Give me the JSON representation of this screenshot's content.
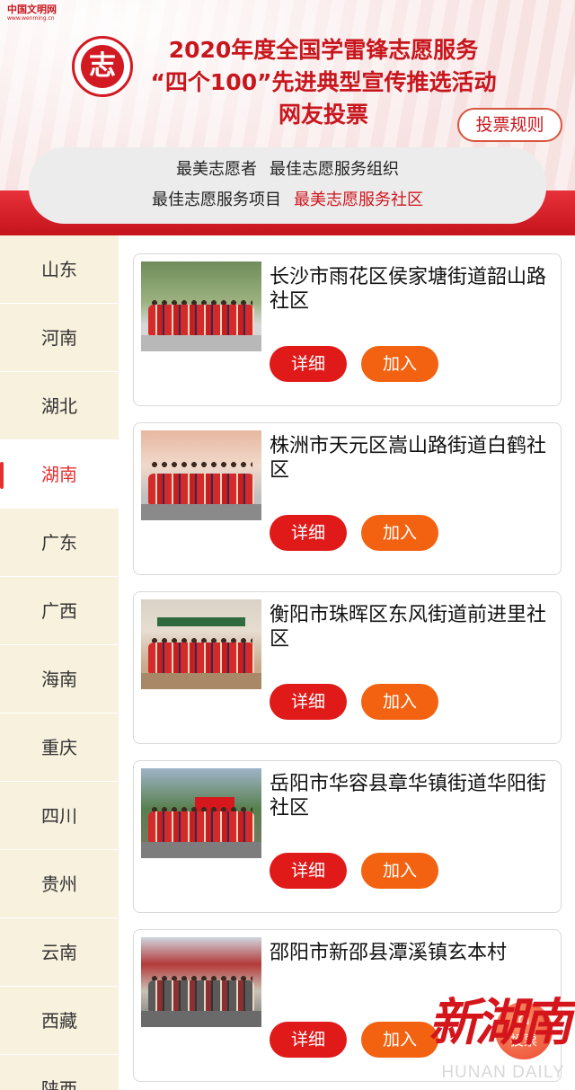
{
  "header": {
    "site_name": "中国文明网",
    "site_url": "www.wenming.cn",
    "emblem_text": "志",
    "title_line1": "2020年度全国学雷锋志愿服务",
    "title_line2": "“四个100”先进典型宣传推选活动",
    "title_line3": "网友投票",
    "rules_button": "投票规则"
  },
  "categories": {
    "row1": [
      "最美志愿者",
      "最佳志愿服务组织"
    ],
    "row2": [
      "最佳志愿服务项目",
      "最美志愿服务社区"
    ],
    "active": "最美志愿服务社区"
  },
  "provinces": [
    "山东",
    "河南",
    "湖北",
    "湖南",
    "广东",
    "广西",
    "海南",
    "重庆",
    "四川",
    "贵州",
    "云南",
    "西藏",
    "陕西"
  ],
  "active_province": "湖南",
  "buttons": {
    "detail": "详细",
    "join": "加入"
  },
  "entries": [
    {
      "title": "长沙市雨花区侯家塘街道韶山路社区"
    },
    {
      "title": "株洲市天元区嵩山路街道白鹤社区"
    },
    {
      "title": "衡阳市珠晖区东风街道前进里社区"
    },
    {
      "title": "岳阳市华容县章华镇街道华阳街社区"
    },
    {
      "title": "邵阳市新邵县潭溪镇玄本村"
    }
  ],
  "vote_fab": {
    "label": "投票",
    "icon": "house-icon"
  },
  "watermark": {
    "cn": "新湖南",
    "en": "HUNAN DAILY"
  },
  "colors": {
    "brand_red": "#c8161d",
    "detail_btn": "#e01919",
    "join_btn": "#f26211",
    "sidebar_bg": "#f8f1de"
  }
}
